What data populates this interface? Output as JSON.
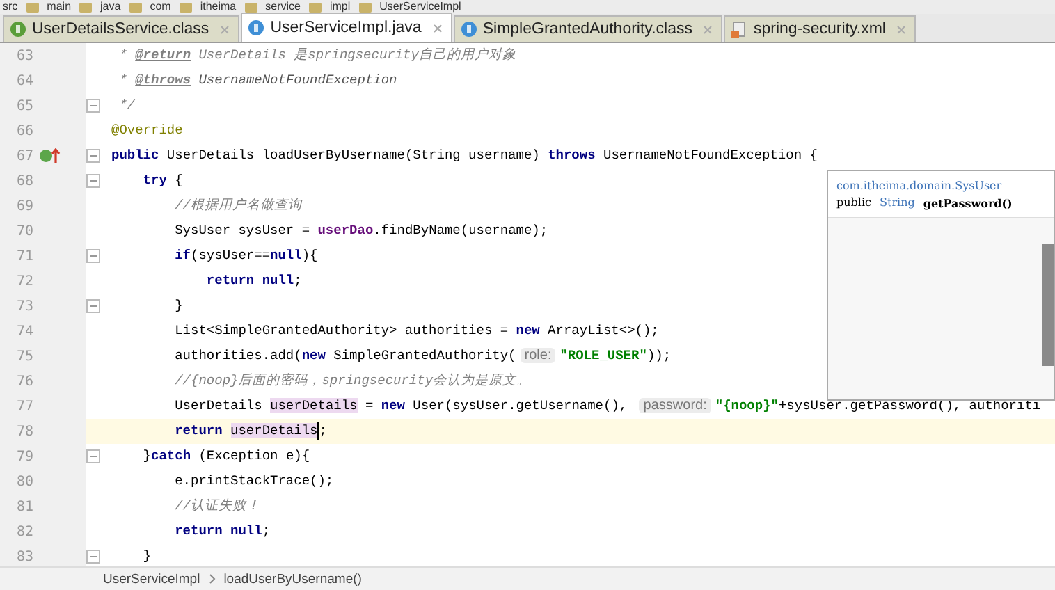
{
  "breadcrumbs": [
    "src",
    "main",
    "java",
    "com",
    "itheima",
    "service",
    "impl",
    "UserServiceImpl"
  ],
  "tabs": [
    {
      "label": "UserDetailsService.class",
      "kind": "interface",
      "selected": false
    },
    {
      "label": "UserServiceImpl.java",
      "kind": "class",
      "selected": true
    },
    {
      "label": "SimpleGrantedAuthority.class",
      "kind": "class",
      "selected": false
    },
    {
      "label": "spring-security.xml",
      "kind": "xml",
      "selected": false
    }
  ],
  "editor": {
    "lines": [
      {
        "number": "63",
        "fold": false,
        "current": false,
        "tokens": [
          {
            "kind": "comment",
            "text": " * "
          },
          {
            "kind": "doctag",
            "text": "@return"
          },
          {
            "kind": "comment",
            "text": " UserDetails 是springsecurity自己的用户对象"
          }
        ]
      },
      {
        "number": "64",
        "fold": false,
        "current": false,
        "tokens": [
          {
            "kind": "comment",
            "text": " * "
          },
          {
            "kind": "doctag",
            "text": "@throws"
          },
          {
            "kind": "docref",
            "text": " UsernameNotFoundException"
          }
        ]
      },
      {
        "number": "65",
        "fold": true,
        "current": false,
        "tokens": [
          {
            "kind": "comment",
            "text": " */"
          }
        ]
      },
      {
        "number": "66",
        "fold": false,
        "current": false,
        "tokens": [
          {
            "kind": "annotation",
            "text": "@Override"
          }
        ]
      },
      {
        "number": "67",
        "fold": true,
        "current": false,
        "override": true,
        "tokens": [
          {
            "kind": "keyword",
            "text": "public"
          },
          {
            "kind": "plain",
            "text": " UserDetails loadUserByUsername(String username) "
          },
          {
            "kind": "keyword",
            "text": "throws"
          },
          {
            "kind": "plain",
            "text": " UsernameNotFoundException {"
          }
        ]
      },
      {
        "number": "68",
        "fold": true,
        "current": false,
        "tokens": [
          {
            "kind": "keyword",
            "text": "    try"
          },
          {
            "kind": "plain",
            "text": " {"
          }
        ]
      },
      {
        "number": "69",
        "fold": false,
        "current": false,
        "tokens": [
          {
            "kind": "comment",
            "text": "        //根据用户名做查询"
          }
        ]
      },
      {
        "number": "70",
        "fold": false,
        "current": false,
        "tokens": [
          {
            "kind": "plain",
            "text": "        SysUser sysUser = "
          },
          {
            "kind": "field",
            "text": "userDao"
          },
          {
            "kind": "plain",
            "text": ".findByName(username);"
          }
        ]
      },
      {
        "number": "71",
        "fold": true,
        "current": false,
        "tokens": [
          {
            "kind": "keyword",
            "text": "        if"
          },
          {
            "kind": "plain",
            "text": "(sysUser=="
          },
          {
            "kind": "keyword",
            "text": "null"
          },
          {
            "kind": "plain",
            "text": "){"
          }
        ]
      },
      {
        "number": "72",
        "fold": false,
        "current": false,
        "tokens": [
          {
            "kind": "keyword",
            "text": "            return null"
          },
          {
            "kind": "plain",
            "text": ";"
          }
        ]
      },
      {
        "number": "73",
        "fold": true,
        "current": false,
        "tokens": [
          {
            "kind": "plain",
            "text": "        }"
          }
        ]
      },
      {
        "number": "74",
        "fold": false,
        "current": false,
        "tokens": [
          {
            "kind": "plain",
            "text": "        List<SimpleGrantedAuthority> authorities = "
          },
          {
            "kind": "keyword",
            "text": "new"
          },
          {
            "kind": "plain",
            "text": " ArrayList<>();"
          }
        ]
      },
      {
        "number": "75",
        "fold": false,
        "current": false,
        "tokens": [
          {
            "kind": "plain",
            "text": "        authorities.add("
          },
          {
            "kind": "keyword",
            "text": "new"
          },
          {
            "kind": "plain",
            "text": " SimpleGrantedAuthority("
          },
          {
            "kind": "hint",
            "text": "role:"
          },
          {
            "kind": "string",
            "text": "\"ROLE_USER\""
          },
          {
            "kind": "plain",
            "text": "));"
          }
        ]
      },
      {
        "number": "76",
        "fold": false,
        "current": false,
        "tokens": [
          {
            "kind": "comment",
            "text": "        //{noop}后面的密码，springsecurity会认为是原文。"
          }
        ]
      },
      {
        "number": "77",
        "fold": false,
        "current": false,
        "tokens": [
          {
            "kind": "plain",
            "text": "        UserDetails "
          },
          {
            "kind": "usage",
            "text": "userDetails"
          },
          {
            "kind": "plain",
            "text": " = "
          },
          {
            "kind": "keyword",
            "text": "new"
          },
          {
            "kind": "plain",
            "text": " User(sysUser.getUsername(), "
          },
          {
            "kind": "hint",
            "text": "password:"
          },
          {
            "kind": "string",
            "text": "\"{noop}\""
          },
          {
            "kind": "plain",
            "text": "+sysUser.getPassword(), authoriti"
          }
        ]
      },
      {
        "number": "78",
        "fold": false,
        "current": true,
        "tokens": [
          {
            "kind": "keyword",
            "text": "        return "
          },
          {
            "kind": "usage",
            "text": "userDetails"
          },
          {
            "kind": "plain",
            "text": ";"
          }
        ]
      },
      {
        "number": "79",
        "fold": true,
        "current": false,
        "tokens": [
          {
            "kind": "plain",
            "text": "    }"
          },
          {
            "kind": "keyword",
            "text": "catch"
          },
          {
            "kind": "plain",
            "text": " (Exception e){"
          }
        ]
      },
      {
        "number": "80",
        "fold": false,
        "current": false,
        "tokens": [
          {
            "kind": "plain",
            "text": "        e.printStackTrace();"
          }
        ]
      },
      {
        "number": "81",
        "fold": false,
        "current": false,
        "tokens": [
          {
            "kind": "comment",
            "text": "        //认证失败！"
          }
        ]
      },
      {
        "number": "82",
        "fold": false,
        "current": false,
        "tokens": [
          {
            "kind": "keyword",
            "text": "        return null"
          },
          {
            "kind": "plain",
            "text": ";"
          }
        ]
      },
      {
        "number": "83",
        "fold": true,
        "current": false,
        "tokens": [
          {
            "kind": "plain",
            "text": "    }"
          }
        ]
      }
    ]
  },
  "doc_popup": {
    "class_path": "com.itheima.domain.SysUser",
    "modifier": "public",
    "return_type": "String",
    "method": "getPassword()"
  },
  "status_bar": {
    "crumbs": [
      "UserServiceImpl",
      "loadUserByUsername()"
    ]
  }
}
